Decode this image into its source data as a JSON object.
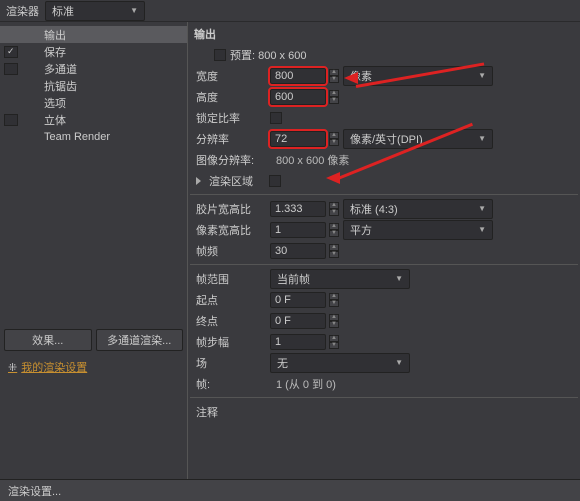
{
  "top": {
    "renderer_label": "渲染器",
    "renderer_value": "标准",
    "output_header": "输出"
  },
  "sidebar": {
    "items": [
      {
        "label": "输出",
        "checked": null,
        "active": true
      },
      {
        "label": "保存",
        "checked": true
      },
      {
        "label": "多通道",
        "checked": false
      },
      {
        "label": "抗锯齿",
        "checked": null
      },
      {
        "label": "选项",
        "checked": null
      },
      {
        "label": "立体",
        "checked": false
      },
      {
        "label": "Team Render",
        "checked": null
      }
    ],
    "btn_effects": "效果...",
    "btn_multipass": "多通道渲染...",
    "my_settings": "我的渲染设置"
  },
  "out": {
    "preset_label": "预置: 800 x 600",
    "width_label": "宽度",
    "width_val": "800",
    "height_label": "高度",
    "height_val": "600",
    "unit_pixel": "像素",
    "lockratio_label": "锁定比率",
    "res_label": "分辨率",
    "res_val": "72",
    "res_unit": "像素/英寸(DPI)",
    "imgres_label": "图像分辨率:",
    "imgres_val": "800 x 600 像素",
    "renderregion_label": "渲染区域",
    "fratio_label": "胶片宽高比",
    "fratio_val": "1.333",
    "fratio_preset": "标准 (4:3)",
    "pratio_label": "像素宽高比",
    "pratio_val": "1",
    "pratio_preset": "平方",
    "fps_label": "帧频",
    "fps_val": "30",
    "framerange_label": "帧范围",
    "framerange_val": "当前帧",
    "start_label": "起点",
    "start_val": "0 F",
    "end_label": "终点",
    "end_val": "0 F",
    "step_label": "帧步幅",
    "step_val": "1",
    "field_label": "场",
    "field_val": "无",
    "frames_label": "帧:",
    "frames_val": "1 (从 0 到 0)",
    "notes_label": "注释"
  },
  "bottom": {
    "render_settings": "渲染设置..."
  }
}
